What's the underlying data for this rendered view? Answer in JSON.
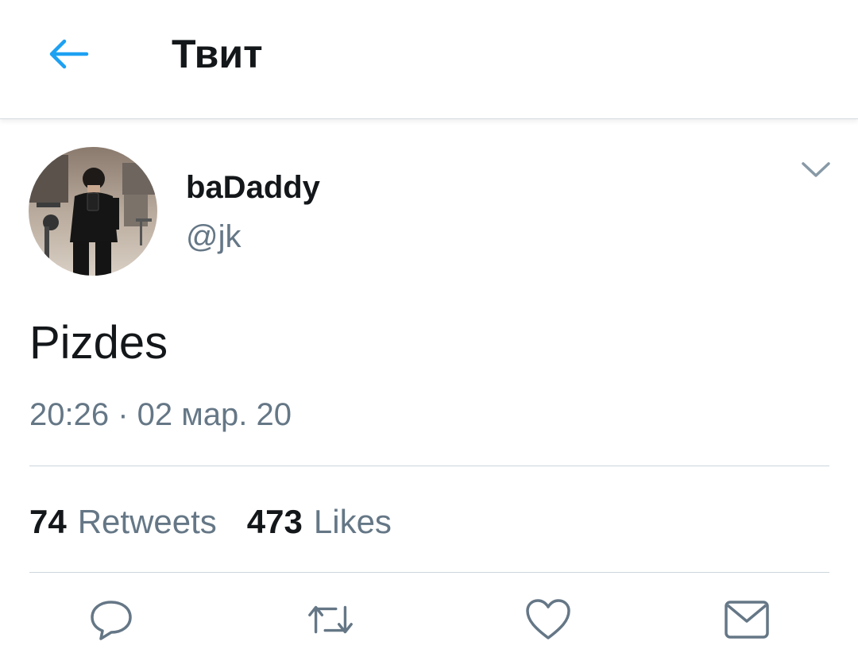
{
  "header": {
    "title": "Твит",
    "back_icon": "arrow-left-icon",
    "accent_color": "#1da1f2"
  },
  "tweet": {
    "display_name": "baDaddy",
    "handle": "@jk",
    "text": "Pizdes",
    "timestamp": "20:26 · 02 мар. 20",
    "menu_icon": "chevron-down-icon"
  },
  "stats": {
    "retweets_count": "74",
    "retweets_label": "Retweets",
    "likes_count": "473",
    "likes_label": "Likes"
  },
  "actions": [
    {
      "icon": "reply-icon"
    },
    {
      "icon": "retweet-icon"
    },
    {
      "icon": "like-icon"
    },
    {
      "icon": "share-icon"
    }
  ],
  "colors": {
    "text_primary": "#14171a",
    "text_secondary": "#657786",
    "divider": "#ccd6dd"
  }
}
